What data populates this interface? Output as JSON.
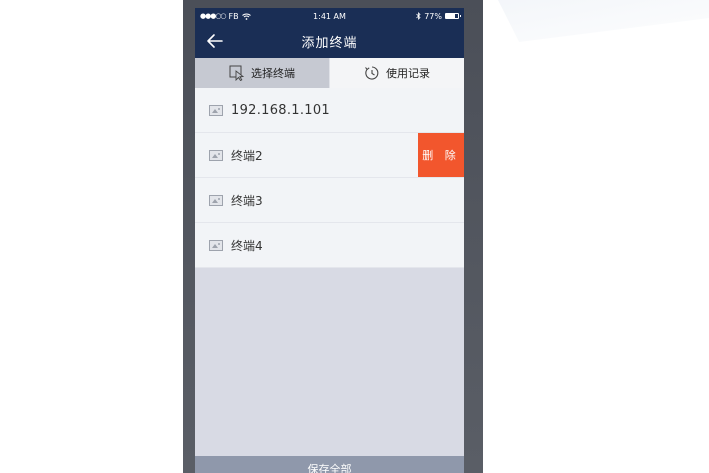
{
  "status_bar": {
    "carrier": "FB",
    "time": "1:41 AM",
    "battery": "77%",
    "battery_level": 0.77
  },
  "nav": {
    "title": "添加终端"
  },
  "tabs": [
    {
      "label": "选择终端",
      "active": true
    },
    {
      "label": "使用记录",
      "active": false
    }
  ],
  "terminals": [
    {
      "label": "192.168.1.101"
    },
    {
      "label": "终端2",
      "action": "删 除"
    },
    {
      "label": "终端3"
    },
    {
      "label": "终端4"
    }
  ],
  "footer": {
    "save_label": "保存全部"
  },
  "colors": {
    "nav_bg": "#1a2e55",
    "delete_bg": "#f2562d",
    "footer_bg": "#8f98ab"
  }
}
